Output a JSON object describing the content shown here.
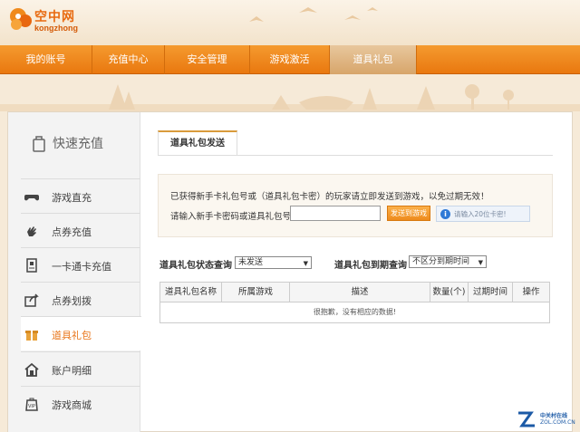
{
  "brand": {
    "name_cn": "空中网",
    "name_en": "kongzhong"
  },
  "nav": {
    "items": [
      {
        "label": "我的账号"
      },
      {
        "label": "充值中心"
      },
      {
        "label": "安全管理"
      },
      {
        "label": "游戏激活"
      },
      {
        "label": "道具礼包",
        "active": true
      }
    ]
  },
  "sidebar": {
    "title": "快速充值",
    "items": [
      {
        "label": "游戏直充",
        "icon": "gamepad-icon"
      },
      {
        "label": "点券充值",
        "icon": "hand-icon"
      },
      {
        "label": "一卡通卡充值",
        "icon": "card-icon"
      },
      {
        "label": "点券划拨",
        "icon": "share-icon"
      },
      {
        "label": "道具礼包",
        "icon": "gift-icon",
        "active": true
      },
      {
        "label": "账户明细",
        "icon": "home-icon"
      },
      {
        "label": "游戏商城",
        "icon": "vip-bag-icon"
      }
    ]
  },
  "main": {
    "tab_label": "道具礼包发送",
    "notice": "已获得新手卡礼包号或（道具礼包卡密）的玩家请立即发送到游戏，以免过期无效！",
    "input_label": "请输入新手卡密码或道具礼包号",
    "input_value": "",
    "send_button": "发送到游戏",
    "hint": "请输入20位卡密!",
    "status_filter": {
      "label": "道具礼包状态查询",
      "value": "未发送"
    },
    "expiry_filter": {
      "label": "道具礼包到期查询",
      "value": "不区分到期时间"
    },
    "table": {
      "columns": [
        "道具礼包名称",
        "所属游戏",
        "描述",
        "数量(个)",
        "过期时间",
        "操作"
      ],
      "empty_message": "很抱歉，没有相应的数据!"
    }
  },
  "watermark": {
    "line1": "中关村在线",
    "line2": "ZOL.COM.CN"
  },
  "colors": {
    "nav_orange": "#ef8a1e",
    "active_tab": "#dcae75",
    "accent": "#e8751a",
    "hint_blue": "#2f7ad6"
  }
}
